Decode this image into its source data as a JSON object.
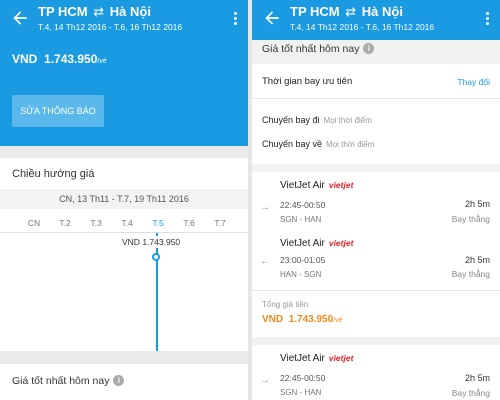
{
  "left": {
    "header": {
      "from": "TP HCM",
      "swap": "⇄",
      "to": "Hà Nội",
      "dates": "T.4, 14 Th12 2016 - T.6, 16 Th12 2016"
    },
    "price": {
      "currency": "VND",
      "amount": "1.743.950",
      "unit": "/vé"
    },
    "edit_button": "SỬA THÔNG BÁO",
    "trend_title": "Chiều hướng giá",
    "range": "CN, 13 Th11 - T.7, 19 Th11 2016",
    "days": [
      "CN",
      "T.2",
      "T.3",
      "T.4",
      "T.5",
      "T.6",
      "T.7"
    ],
    "selected_day": "T.5",
    "tooltip": {
      "currency": "VND",
      "amount": "1.743.950"
    },
    "chart_data": {
      "type": "line",
      "categories": [
        "CN",
        "T.2",
        "T.3",
        "T.4",
        "T.5",
        "T.6",
        "T.7"
      ],
      "highlight": {
        "x": "T.5",
        "label": "VND 1.743.950"
      }
    },
    "best_today": "Giá tốt nhất hôm nay"
  },
  "right": {
    "header": {
      "from": "TP HCM",
      "swap": "⇄",
      "to": "Hà Nội",
      "dates": "T.4, 14 Th12 2016 - T.6, 16 Th12 2016"
    },
    "best_today": "Giá tốt nhất hôm nay",
    "pref_time": "Thời gian bay ưu tiên",
    "change": "Thay đổi",
    "outbound_label": "Chuyến bay đi",
    "outbound_value": "Mọi thời điểm",
    "return_label": "Chuyến bay về",
    "return_value": "Mọi thời điểm",
    "offers": [
      {
        "outbound": {
          "airline": "VietJet Air",
          "logo": "vietjet",
          "time": "22:45-00:50",
          "route": "SGN - HAN",
          "duration": "2h 5m",
          "stops": "Bay thẳng"
        },
        "inbound": {
          "airline": "VietJet Air",
          "logo": "vietjet",
          "time": "23:00-01:05",
          "route": "HAN - SGN",
          "duration": "2h 5m",
          "stops": "Bay thẳng"
        },
        "total_label": "Tổng giá tiền",
        "total": {
          "currency": "VND",
          "amount": "1.743.950",
          "unit": "/vé"
        }
      },
      {
        "outbound": {
          "airline": "VietJet Air",
          "logo": "vietjet",
          "time": "22:45-00:50",
          "route": "SGN - HAN",
          "duration": "2h 5m",
          "stops": "Bay thẳng"
        }
      }
    ]
  }
}
